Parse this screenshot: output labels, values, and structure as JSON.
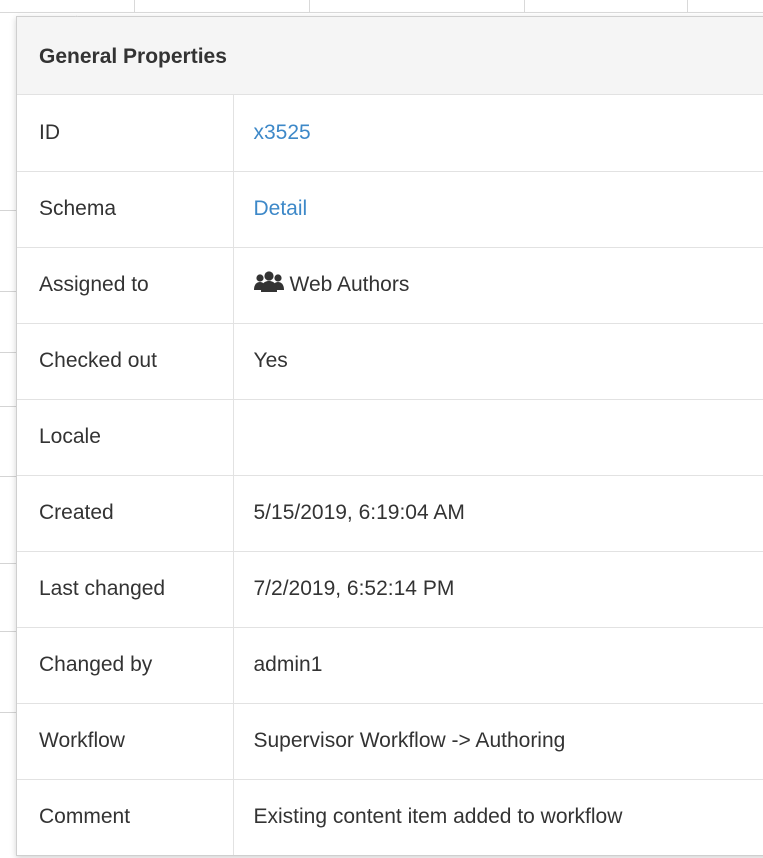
{
  "panel": {
    "title": "General Properties"
  },
  "rows": [
    {
      "label": "ID",
      "value": "x3525",
      "link": true
    },
    {
      "label": "Schema",
      "value": "Detail",
      "link": true
    },
    {
      "label": "Assigned to",
      "value": "Web Authors",
      "icon": "group-icon"
    },
    {
      "label": "Checked out",
      "value": "Yes"
    },
    {
      "label": "Locale",
      "value": ""
    },
    {
      "label": "Created",
      "value": "5/15/2019, 6:19:04 AM"
    },
    {
      "label": "Last changed",
      "value": "7/2/2019, 6:52:14 PM"
    },
    {
      "label": "Changed by",
      "value": "admin1"
    },
    {
      "label": "Workflow",
      "value": "Supervisor Workflow -> Authoring"
    },
    {
      "label": "Comment",
      "value": "Existing content item added to workflow"
    }
  ],
  "colors": {
    "link": "#3d88c8",
    "text": "#333333",
    "header_bg": "#f5f5f5",
    "border": "#e2e2e2"
  }
}
